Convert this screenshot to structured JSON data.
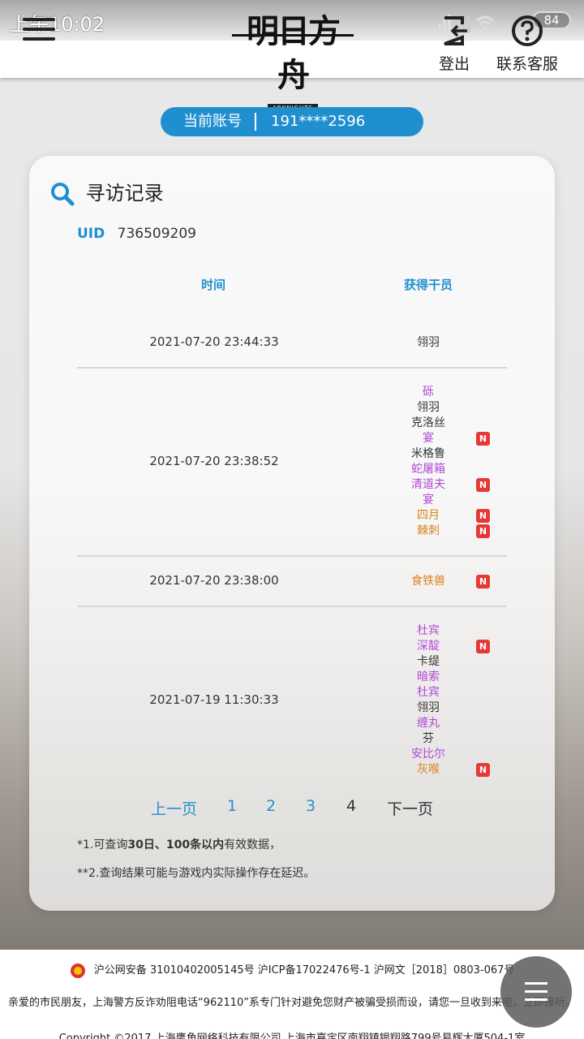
{
  "statusbar": {
    "time": "上午10:02",
    "battery": "84"
  },
  "header": {
    "logo_cn": "明日方舟",
    "logo_en": "ARKNIGHTS",
    "logout_label": "登出",
    "support_label": "联系客服"
  },
  "account": {
    "label": "当前账号",
    "value": "191****2596"
  },
  "card": {
    "title": "寻访记录",
    "uid_label": "UID",
    "uid_value": "736509209",
    "col_time": "时间",
    "col_ops": "获得干员"
  },
  "colors": {
    "accent": "#1f8fd0",
    "rarity_3": "#333333",
    "rarity_4": "#b04ad6",
    "rarity_5": "#d9821e",
    "new_badge": "#e53935"
  },
  "records": [
    {
      "time": "2021-07-20 23:44:33",
      "ops": [
        {
          "name": "翎羽",
          "rarity": 3,
          "new": false
        }
      ]
    },
    {
      "time": "2021-07-20 23:38:52",
      "ops": [
        {
          "name": "砾",
          "rarity": 4,
          "new": false
        },
        {
          "name": "翎羽",
          "rarity": 3,
          "new": false
        },
        {
          "name": "克洛丝",
          "rarity": 3,
          "new": false
        },
        {
          "name": "宴",
          "rarity": 4,
          "new": true
        },
        {
          "name": "米格鲁",
          "rarity": 3,
          "new": false
        },
        {
          "name": "蛇屠箱",
          "rarity": 4,
          "new": false
        },
        {
          "name": "清道夫",
          "rarity": 4,
          "new": true
        },
        {
          "name": "宴",
          "rarity": 4,
          "new": false
        },
        {
          "name": "四月",
          "rarity": 5,
          "new": true
        },
        {
          "name": "棘刺",
          "rarity": 5,
          "new": true
        }
      ]
    },
    {
      "time": "2021-07-20 23:38:00",
      "ops": [
        {
          "name": "食铁兽",
          "rarity": 5,
          "new": true
        }
      ]
    },
    {
      "time": "2021-07-19 11:30:33",
      "ops": [
        {
          "name": "杜宾",
          "rarity": 4,
          "new": false
        },
        {
          "name": "深靛",
          "rarity": 4,
          "new": true
        },
        {
          "name": "卡缇",
          "rarity": 3,
          "new": false
        },
        {
          "name": "暗索",
          "rarity": 4,
          "new": false
        },
        {
          "name": "杜宾",
          "rarity": 4,
          "new": false
        },
        {
          "name": "翎羽",
          "rarity": 3,
          "new": false
        },
        {
          "name": "缠丸",
          "rarity": 4,
          "new": false
        },
        {
          "name": "芬",
          "rarity": 3,
          "new": false
        },
        {
          "name": "安比尔",
          "rarity": 4,
          "new": false
        },
        {
          "name": "灰喉",
          "rarity": 5,
          "new": true
        }
      ]
    }
  ],
  "new_badge_text": "N",
  "pager": {
    "prev": "上一页",
    "pages": [
      "1",
      "2",
      "3",
      "4"
    ],
    "current": "4",
    "next": "下一页"
  },
  "notes": {
    "n1_prefix": "*1.可查询",
    "n1_bold": "30日、100条以内",
    "n1_suffix": "有效数据，",
    "n2": "**2.查询结果可能与游戏内实际操作存在延迟。"
  },
  "footer": {
    "line1": "沪公网安备 31010402005145号  沪ICP备17022476号-1  沪网文［2018］0803-067号",
    "line2": "亲爱的市民朋友，上海警方反诈劝阻电话“962110”系专门针对避免您财产被骗受损而设，请您一旦收到来电，立即接听。",
    "line3": "Copyright ©2017 上海鹰角网络科技有限公司  上海市嘉定区南翔镇银翔路799号易辉大厦504-1室"
  }
}
